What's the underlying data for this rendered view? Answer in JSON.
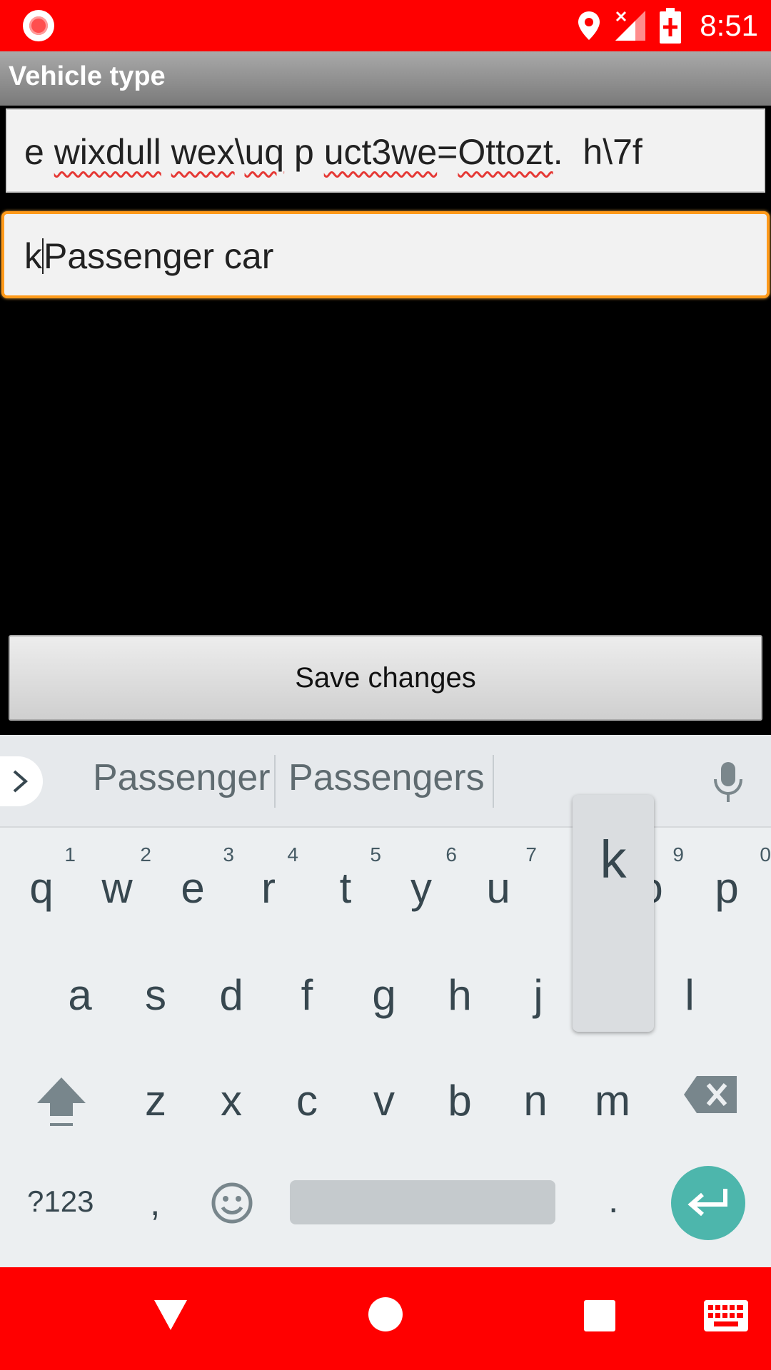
{
  "status_bar": {
    "time": "8:51",
    "icons": [
      "record-icon",
      "location-icon",
      "signal-no-data-icon",
      "battery-charging-icon"
    ],
    "color": "#ff0000"
  },
  "app": {
    "title": "Vehicle type"
  },
  "fields": {
    "field1_value": "e wixdull wex\\uq p uct3we=Ottozt.  h\\7f",
    "field2_before_cursor": "k",
    "field2_after_cursor": "Passenger car",
    "focus_color": "#ff9a1a"
  },
  "actions": {
    "save_label": "Save changes"
  },
  "keyboard": {
    "suggestions": [
      "Passenger",
      "Passengers"
    ],
    "row1": [
      {
        "ch": "q",
        "num": "1"
      },
      {
        "ch": "w",
        "num": "2"
      },
      {
        "ch": "e",
        "num": "3"
      },
      {
        "ch": "r",
        "num": "4"
      },
      {
        "ch": "t",
        "num": "5"
      },
      {
        "ch": "y",
        "num": "6"
      },
      {
        "ch": "u",
        "num": "7"
      },
      {
        "ch": "o",
        "num": "9"
      },
      {
        "ch": "p",
        "num": "0"
      }
    ],
    "row2": [
      "a",
      "s",
      "d",
      "f",
      "g",
      "h",
      "j",
      "l"
    ],
    "row3": [
      "z",
      "x",
      "c",
      "v",
      "b",
      "n",
      "m"
    ],
    "popup_key": "k",
    "symbols_label": "?123",
    "comma": ",",
    "period": ".",
    "accent_color": "#4db6ac"
  },
  "nav_bar": {
    "icons": [
      "back-icon",
      "home-icon",
      "recents-icon",
      "keyboard-switch-icon"
    ],
    "color": "#ff0000"
  }
}
